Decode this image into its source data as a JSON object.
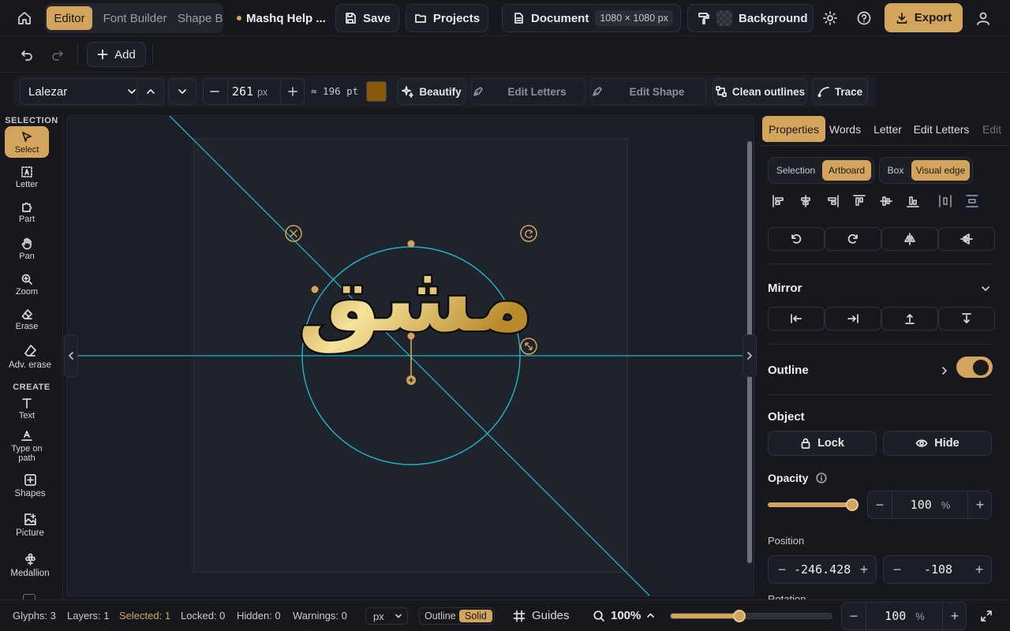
{
  "top": {
    "modes": [
      "Editor",
      "Font Builder",
      "Shape Builder"
    ],
    "project_title": "Mashq Help ...",
    "save": "Save",
    "projects": "Projects",
    "document": "Document",
    "document_size": "1080 × 1080 px",
    "background": "Background",
    "export": "Export"
  },
  "row2": {
    "add": "Add"
  },
  "format": {
    "font": "Lalezar",
    "size": "261",
    "size_unit": "px",
    "size_pt": "≈ 196 pt",
    "color": "#8a5a0c",
    "beautify": "Beautify",
    "edit_letters": "Edit Letters",
    "edit_shape": "Edit Shape",
    "clean_outlines": "Clean outlines",
    "trace": "Trace"
  },
  "tools": {
    "selection_header": "SELECTION",
    "create_header": "CREATE",
    "select": "Select",
    "letter": "Letter",
    "part": "Part",
    "pan": "Pan",
    "zoom": "Zoom",
    "erase": "Erase",
    "adv_erase": "Adv. erase",
    "text": "Text",
    "type_on_path": "Type on path",
    "shapes": "Shapes",
    "picture": "Picture",
    "medallion": "Medallion"
  },
  "canvas": {
    "text": "مشق"
  },
  "panel": {
    "tabs": [
      "Properties",
      "Words",
      "Letter",
      "Edit Letters",
      "Edit"
    ],
    "align_to": [
      "Selection",
      "Artboard"
    ],
    "align_mode": [
      "Box",
      "Visual edge"
    ],
    "mirror": "Mirror",
    "outline": "Outline",
    "outline_on": true,
    "object": "Object",
    "lock": "Lock",
    "hide": "Hide",
    "opacity": "Opacity",
    "opacity_value": "100",
    "opacity_unit": "%",
    "position": "Position",
    "pos_x": "-246.428",
    "pos_y": "-108",
    "rotation": "Rotation"
  },
  "status": {
    "glyphs": "Glyphs: 3",
    "layers": "Layers: 1",
    "selected": "Selected: 1",
    "locked": "Locked: 0",
    "hidden": "Hidden: 0",
    "warnings": "Warnings: 0",
    "unit": "px",
    "view_outline": "Outline",
    "view_solid": "Solid",
    "guides": "Guides",
    "zoom": "100%",
    "zoom_value": "100",
    "zoom_unit": "%"
  },
  "colors": {
    "accent": "#d2a45c",
    "guide": "#1fb6c8",
    "bg": "#16181e"
  }
}
